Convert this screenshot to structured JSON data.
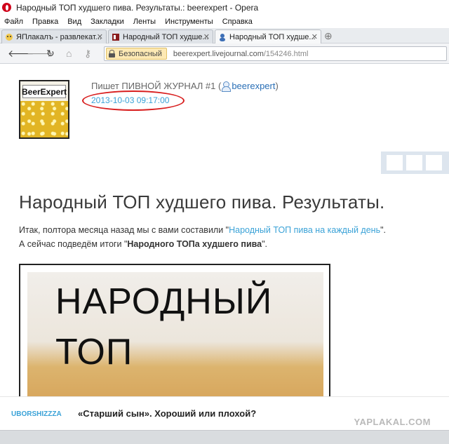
{
  "window": {
    "title": "Народный ТОП худшего пива. Результаты.: beerexpert - Opera"
  },
  "menu": [
    "Файл",
    "Правка",
    "Вид",
    "Закладки",
    "Ленты",
    "Инструменты",
    "Справка"
  ],
  "tabs": [
    {
      "label": "ЯПлакалъ - развлекат...",
      "active": false
    },
    {
      "label": "Народный ТОП худше...",
      "active": false
    },
    {
      "label": "Народный ТОП худше...",
      "active": true
    }
  ],
  "address": {
    "security_label": "Безопасный",
    "url_host": "beerexpert.livejournal.com",
    "url_path": "/154246.html"
  },
  "post": {
    "userpic_text": "BeerExpert",
    "author_prefix": "Пишет ПИВНОЙ ЖУРНАЛ #1 (",
    "author_user": "beerexpert",
    "author_suffix": ")",
    "date": "2013-10-03 09:17:00",
    "title": "Народный ТОП худшего пива. Результаты.",
    "intro_line1_prefix": "Итак, полтора месяца назад мы с вами составили \"",
    "intro_line1_link": "Народный ТОП пива на каждый день",
    "intro_line1_suffix": "\".",
    "intro_line2_prefix": "А сейчас подведём итоги \"",
    "intro_line2_bold": "Народного ТОПа худшего пива",
    "intro_line2_suffix": "\".",
    "image_line1": "НАРОДНЫЙ",
    "image_line2": "ТОП"
  },
  "footer": {
    "username": "UBORSHIZZZA",
    "title": "«Старший сын». Хороший или плохой?"
  },
  "watermark": "YAPLAKAL.COM",
  "colors": {
    "accent_link": "#3aa2d7",
    "highlight_ring": "#d81e1e",
    "opera_red": "#d0021b"
  }
}
